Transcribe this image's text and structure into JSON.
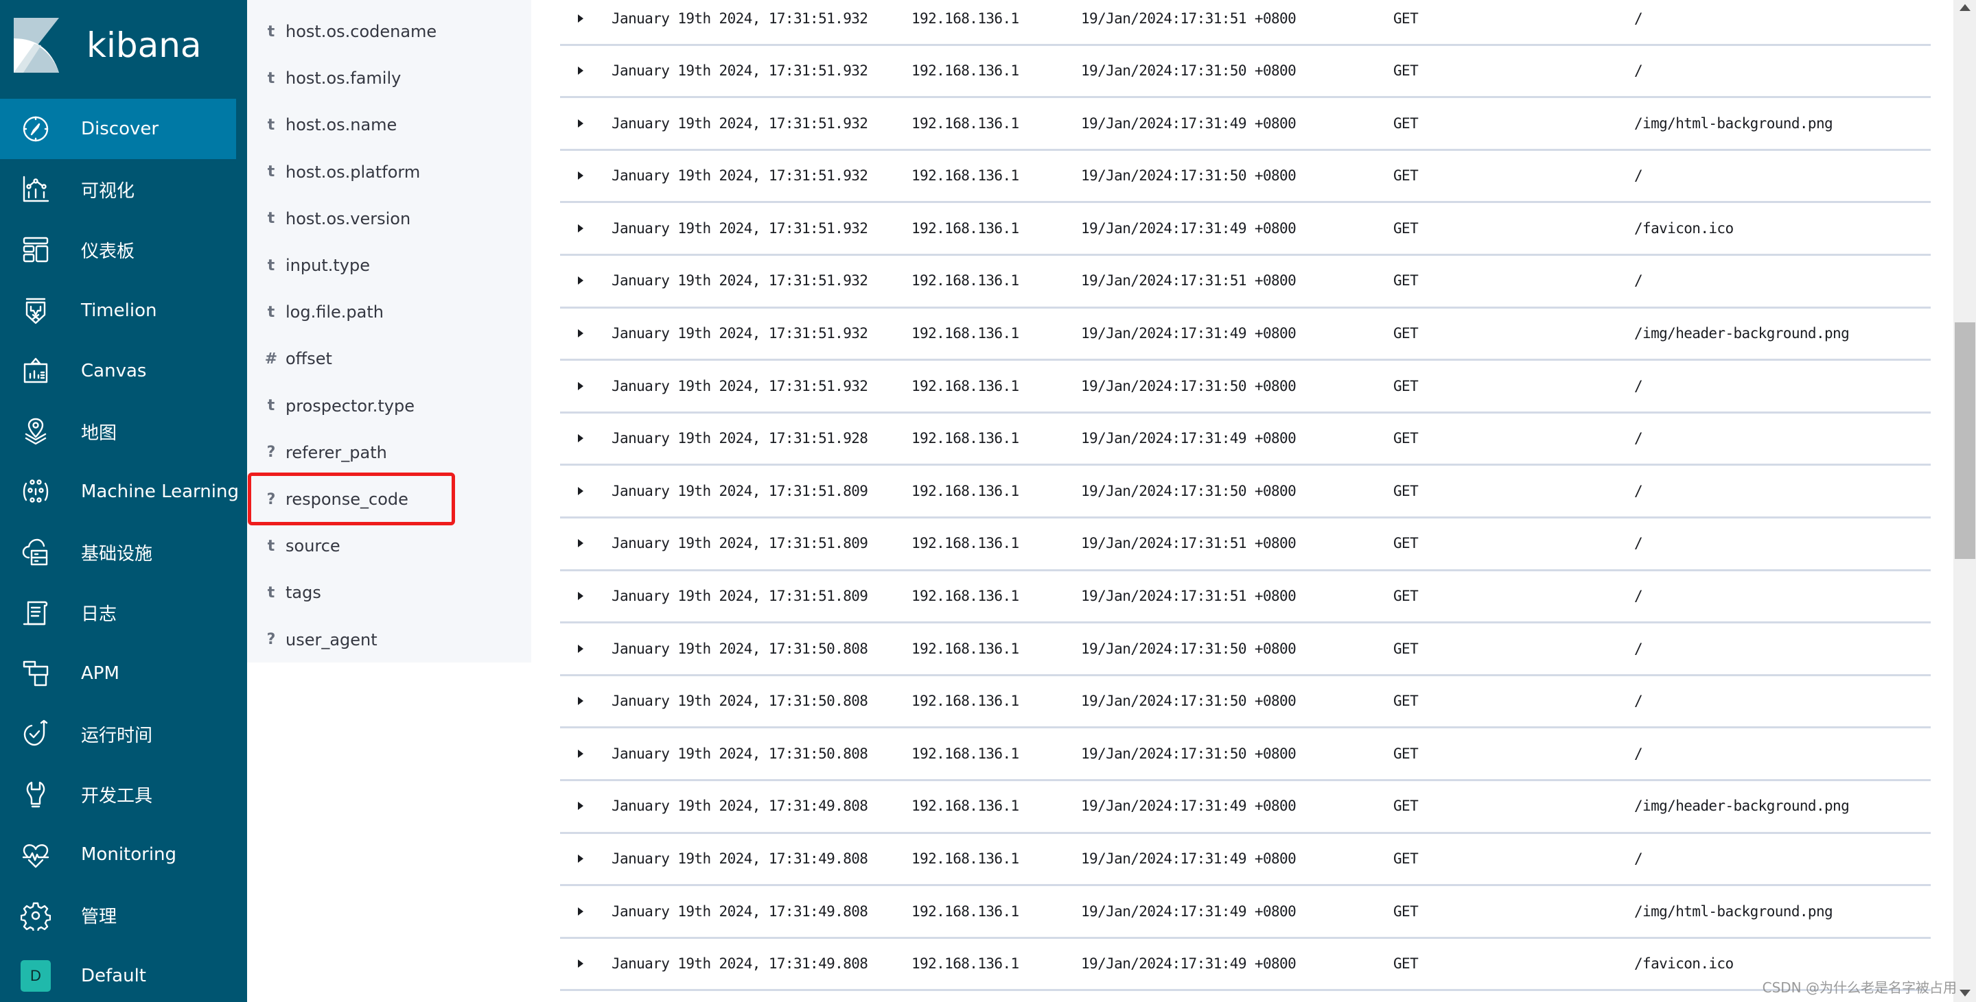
{
  "app": {
    "brand": "kibana",
    "colors": {
      "nav_bg": "#005571",
      "nav_active": "#0079a5",
      "field_list_bg": "#f5f7fa",
      "row_border": "#d3dae6",
      "highlight": "#ee1c1c",
      "space_badge": "#20b9ab"
    }
  },
  "nav": {
    "items": [
      {
        "label": "Discover",
        "icon": "compass-icon",
        "active": true
      },
      {
        "label": "可视化",
        "icon": "visualize-icon"
      },
      {
        "label": "仪表板",
        "icon": "dashboard-icon"
      },
      {
        "label": "Timelion",
        "icon": "timelion-icon"
      },
      {
        "label": "Canvas",
        "icon": "canvas-icon"
      },
      {
        "label": "地图",
        "icon": "maps-icon"
      },
      {
        "label": "Machine Learning",
        "icon": "machine-learning-icon"
      },
      {
        "label": "基础设施",
        "icon": "infrastructure-icon"
      },
      {
        "label": "日志",
        "icon": "logs-icon"
      },
      {
        "label": "APM",
        "icon": "apm-icon"
      },
      {
        "label": "运行时间",
        "icon": "uptime-icon"
      },
      {
        "label": "开发工具",
        "icon": "dev-tools-icon"
      },
      {
        "label": "Monitoring",
        "icon": "monitoring-icon"
      },
      {
        "label": "管理",
        "icon": "gear-icon"
      }
    ],
    "space": {
      "badge": "D",
      "label": "Default"
    }
  },
  "fields": [
    {
      "type": "t",
      "name": "host.os.codename"
    },
    {
      "type": "t",
      "name": "host.os.family"
    },
    {
      "type": "t",
      "name": "host.os.name"
    },
    {
      "type": "t",
      "name": "host.os.platform"
    },
    {
      "type": "t",
      "name": "host.os.version"
    },
    {
      "type": "t",
      "name": "input.type"
    },
    {
      "type": "t",
      "name": "log.file.path"
    },
    {
      "type": "#",
      "name": "offset"
    },
    {
      "type": "t",
      "name": "prospector.type"
    },
    {
      "type": "?",
      "name": "referer_path"
    },
    {
      "type": "?",
      "name": "response_code",
      "highlighted": true
    },
    {
      "type": "t",
      "name": "source"
    },
    {
      "type": "t",
      "name": "tags"
    },
    {
      "type": "?",
      "name": "user_agent"
    }
  ],
  "documents": [
    {
      "time": "January 19th 2024, 17:31:51.932",
      "ip": "192.168.136.1",
      "timestamp": "19/Jan/2024:17:31:51 +0800",
      "method": "GET",
      "path": "/"
    },
    {
      "time": "January 19th 2024, 17:31:51.932",
      "ip": "192.168.136.1",
      "timestamp": "19/Jan/2024:17:31:50 +0800",
      "method": "GET",
      "path": "/"
    },
    {
      "time": "January 19th 2024, 17:31:51.932",
      "ip": "192.168.136.1",
      "timestamp": "19/Jan/2024:17:31:49 +0800",
      "method": "GET",
      "path": "/img/html-background.png"
    },
    {
      "time": "January 19th 2024, 17:31:51.932",
      "ip": "192.168.136.1",
      "timestamp": "19/Jan/2024:17:31:50 +0800",
      "method": "GET",
      "path": "/"
    },
    {
      "time": "January 19th 2024, 17:31:51.932",
      "ip": "192.168.136.1",
      "timestamp": "19/Jan/2024:17:31:49 +0800",
      "method": "GET",
      "path": "/favicon.ico"
    },
    {
      "time": "January 19th 2024, 17:31:51.932",
      "ip": "192.168.136.1",
      "timestamp": "19/Jan/2024:17:31:51 +0800",
      "method": "GET",
      "path": "/"
    },
    {
      "time": "January 19th 2024, 17:31:51.932",
      "ip": "192.168.136.1",
      "timestamp": "19/Jan/2024:17:31:49 +0800",
      "method": "GET",
      "path": "/img/header-background.png"
    },
    {
      "time": "January 19th 2024, 17:31:51.932",
      "ip": "192.168.136.1",
      "timestamp": "19/Jan/2024:17:31:50 +0800",
      "method": "GET",
      "path": "/"
    },
    {
      "time": "January 19th 2024, 17:31:51.928",
      "ip": "192.168.136.1",
      "timestamp": "19/Jan/2024:17:31:49 +0800",
      "method": "GET",
      "path": "/"
    },
    {
      "time": "January 19th 2024, 17:31:51.809",
      "ip": "192.168.136.1",
      "timestamp": "19/Jan/2024:17:31:50 +0800",
      "method": "GET",
      "path": "/"
    },
    {
      "time": "January 19th 2024, 17:31:51.809",
      "ip": "192.168.136.1",
      "timestamp": "19/Jan/2024:17:31:51 +0800",
      "method": "GET",
      "path": "/"
    },
    {
      "time": "January 19th 2024, 17:31:51.809",
      "ip": "192.168.136.1",
      "timestamp": "19/Jan/2024:17:31:51 +0800",
      "method": "GET",
      "path": "/"
    },
    {
      "time": "January 19th 2024, 17:31:50.808",
      "ip": "192.168.136.1",
      "timestamp": "19/Jan/2024:17:31:50 +0800",
      "method": "GET",
      "path": "/"
    },
    {
      "time": "January 19th 2024, 17:31:50.808",
      "ip": "192.168.136.1",
      "timestamp": "19/Jan/2024:17:31:50 +0800",
      "method": "GET",
      "path": "/"
    },
    {
      "time": "January 19th 2024, 17:31:50.808",
      "ip": "192.168.136.1",
      "timestamp": "19/Jan/2024:17:31:50 +0800",
      "method": "GET",
      "path": "/"
    },
    {
      "time": "January 19th 2024, 17:31:49.808",
      "ip": "192.168.136.1",
      "timestamp": "19/Jan/2024:17:31:49 +0800",
      "method": "GET",
      "path": "/img/header-background.png"
    },
    {
      "time": "January 19th 2024, 17:31:49.808",
      "ip": "192.168.136.1",
      "timestamp": "19/Jan/2024:17:31:49 +0800",
      "method": "GET",
      "path": "/"
    },
    {
      "time": "January 19th 2024, 17:31:49.808",
      "ip": "192.168.136.1",
      "timestamp": "19/Jan/2024:17:31:49 +0800",
      "method": "GET",
      "path": "/img/html-background.png"
    },
    {
      "time": "January 19th 2024, 17:31:49.808",
      "ip": "192.168.136.1",
      "timestamp": "19/Jan/2024:17:31:49 +0800",
      "method": "GET",
      "path": "/favicon.ico"
    }
  ],
  "scrollbar": {
    "position_fraction": 0.32,
    "visible_fraction": 0.24
  },
  "watermark": "CSDN @为什么老是名字被占用"
}
